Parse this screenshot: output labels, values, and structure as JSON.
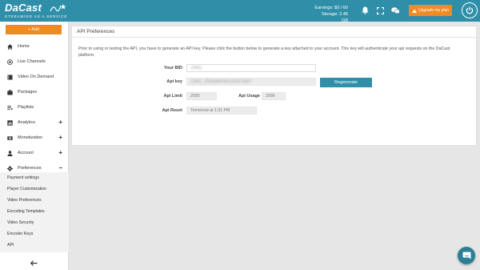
{
  "header": {
    "logo_text": "DaCast",
    "tagline": "STREAMING AS A SERVICE",
    "earnings": "Earnings: $0 / 60",
    "storage": "Storage: 2.46 GB",
    "upgrade_label": "Upgrade my plan",
    "icons": [
      "bell-icon",
      "expand-icon",
      "chat-icon",
      "warning-icon",
      "power-icon"
    ]
  },
  "sidebar": {
    "add_label": "+ Add",
    "items": [
      {
        "label": "Home",
        "icon": "home-icon"
      },
      {
        "label": "Live Channels",
        "icon": "live-icon"
      },
      {
        "label": "Video On Demand",
        "icon": "video-icon"
      },
      {
        "label": "Packages",
        "icon": "package-icon"
      },
      {
        "label": "Playlists",
        "icon": "playlist-icon"
      },
      {
        "label": "Analytics",
        "icon": "analytics-icon",
        "expander": "+"
      },
      {
        "label": "Monetization",
        "icon": "money-icon",
        "expander": "+"
      },
      {
        "label": "Account",
        "icon": "user-icon",
        "expander": "+"
      },
      {
        "label": "Preferences",
        "icon": "gear-icon",
        "expander": "−"
      }
    ],
    "sub_items": [
      "Payment settings",
      "Player Customization",
      "Video Preferences",
      "Encoding Templates",
      "Video Security",
      "Encoder Keys",
      "API"
    ]
  },
  "panel": {
    "title": "API Preferences",
    "intro": "Prior to using or testing the API, you have to generate an API key. Please click the button below to generate a key attached to your account. This key will authenticate your api requests on the DaCast platform.",
    "bid_label": "Your BID",
    "bid_value": "12461",
    "key_label": "Api key",
    "key_value": "12461_1f93ab8e09e1a2667a8d7",
    "regenerate_label": "Regenerate",
    "limit_label": "Api Limit",
    "limit_value": "2000",
    "usage_label": "Api Usage",
    "usage_value": "2000",
    "reset_label": "Api Reset",
    "reset_value": "Tomorrow at 1:31 PM"
  },
  "colors": {
    "brand": "#2f8fa9",
    "accent": "#f08a24"
  }
}
